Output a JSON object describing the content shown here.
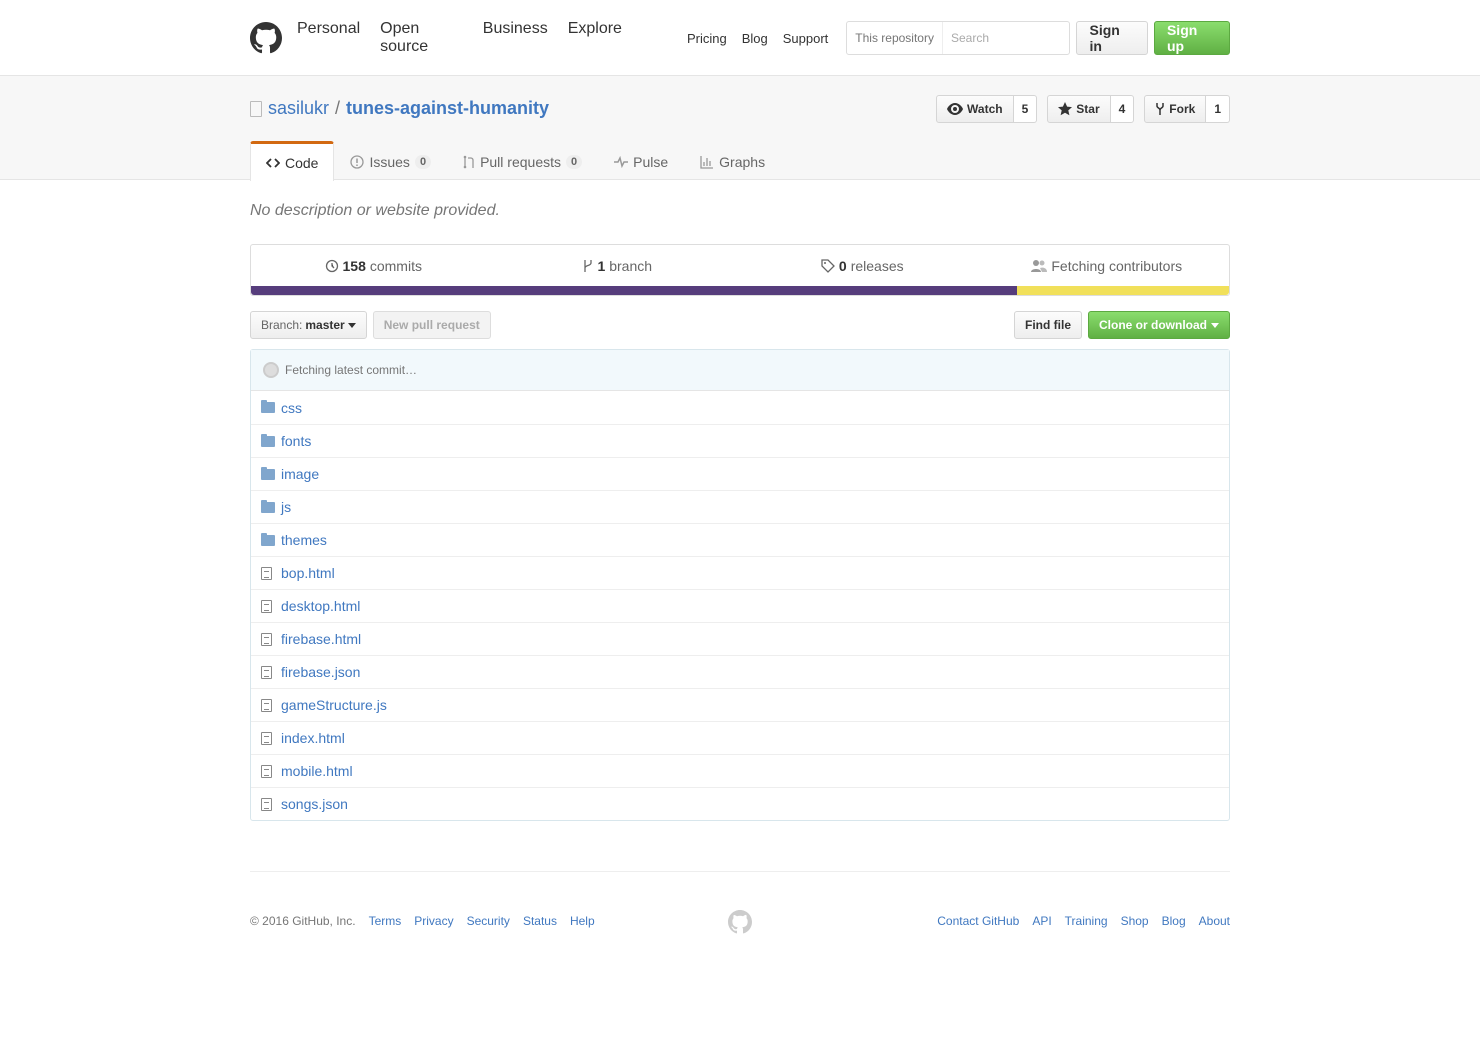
{
  "header": {
    "nav_main": [
      "Personal",
      "Open source",
      "Business",
      "Explore"
    ],
    "nav_sub": [
      "Pricing",
      "Blog",
      "Support"
    ],
    "search_scope": "This repository",
    "search_placeholder": "Search",
    "signin_label": "Sign in",
    "signup_label": "Sign up"
  },
  "repo": {
    "owner": "sasilukr",
    "separator": "/",
    "name": "tunes-against-humanity",
    "watch_label": "Watch",
    "watch_count": "5",
    "star_label": "Star",
    "star_count": "4",
    "fork_label": "Fork",
    "fork_count": "1"
  },
  "tabs": [
    {
      "label": "Code",
      "icon": "code-icon",
      "active": true
    },
    {
      "label": "Issues",
      "icon": "issue-icon",
      "counter": "0"
    },
    {
      "label": "Pull requests",
      "icon": "pull-request-icon",
      "counter": "0"
    },
    {
      "label": "Pulse",
      "icon": "pulse-icon"
    },
    {
      "label": "Graphs",
      "icon": "graph-icon"
    }
  ],
  "description": "No description or website provided.",
  "summary": {
    "commits_count": "158",
    "commits_label": "commits",
    "branch_count": "1",
    "branch_label": "branch",
    "releases_count": "0",
    "releases_label": "releases",
    "contributors_label": "Fetching contributors"
  },
  "language_bar": [
    {
      "color": "#563d7c",
      "percent": 78.3
    },
    {
      "color": "#f1e05a",
      "percent": 21.7
    }
  ],
  "filebar": {
    "branch_prefix": "Branch:",
    "branch_name": "master",
    "new_pr_label": "New pull request",
    "find_file_label": "Find file",
    "clone_label": "Clone or download"
  },
  "commit_tease": "Fetching latest commit…",
  "files": [
    {
      "name": "css",
      "type": "dir"
    },
    {
      "name": "fonts",
      "type": "dir"
    },
    {
      "name": "image",
      "type": "dir"
    },
    {
      "name": "js",
      "type": "dir"
    },
    {
      "name": "themes",
      "type": "dir"
    },
    {
      "name": "bop.html",
      "type": "file"
    },
    {
      "name": "desktop.html",
      "type": "file"
    },
    {
      "name": "firebase.html",
      "type": "file"
    },
    {
      "name": "firebase.json",
      "type": "file"
    },
    {
      "name": "gameStructure.js",
      "type": "file"
    },
    {
      "name": "index.html",
      "type": "file"
    },
    {
      "name": "mobile.html",
      "type": "file"
    },
    {
      "name": "songs.json",
      "type": "file"
    }
  ],
  "footer": {
    "copyright": "© 2016 GitHub, Inc.",
    "left_links": [
      "Terms",
      "Privacy",
      "Security",
      "Status",
      "Help"
    ],
    "right_links": [
      "Contact GitHub",
      "API",
      "Training",
      "Shop",
      "Blog",
      "About"
    ]
  }
}
